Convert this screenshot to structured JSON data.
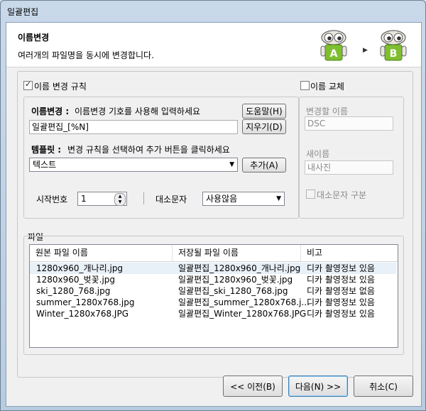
{
  "window": {
    "title": "일괄편집"
  },
  "header": {
    "title": "이름변경",
    "subtitle": "여러개의 파일명을 동시에 변경합니다.",
    "robot_a": "A",
    "robot_b": "B"
  },
  "rename_rule": {
    "checkbox_label": "이름 변경 규칙",
    "checked": true,
    "name_label_bold": "이름변경 :",
    "name_label_desc": " 이름변경 기호를 사용해 입력하세요",
    "help_button": "도움말(H)",
    "clear_button": "지우기(D)",
    "name_value": "일괄편집_[%N]",
    "template_label_bold": "템플릿 :",
    "template_label_desc": " 변경 규칙을 선택하여 추가 버튼을 클릭하세요",
    "template_value": "텍스트",
    "add_button": "추가(A)",
    "start_no_label": "시작번호",
    "start_no_value": "1",
    "case_label": "대소문자",
    "case_value": "사용않음"
  },
  "name_replace": {
    "checkbox_label": "이름 교체",
    "checked": false,
    "find_label": "변경할 이름",
    "find_value": "DSC",
    "new_label": "새이름",
    "new_value": "내사진",
    "case_sensitive_label": "대소문자 구분"
  },
  "files": {
    "group_label": "파일",
    "columns": [
      "원본 파일 이름",
      "저장될 파일 이름",
      "비고"
    ],
    "rows": [
      [
        "1280x960_개나리.jpg",
        "일괄편집_1280x960_개나리.jpg",
        "디카 촬영정보 있음"
      ],
      [
        "1280x960_벚꽃.jpg",
        "일괄편집_1280x960_벚꽃.jpg",
        "디카 촬영정보 있음"
      ],
      [
        "ski_1280_768.jpg",
        "일괄편집_ski_1280_768.jpg",
        "디카 촬영정보 없음"
      ],
      [
        "summer_1280x768.jpg",
        "일괄편집_summer_1280x768.j...",
        "디카 촬영정보 있음"
      ],
      [
        "Winter_1280x768.JPG",
        "일괄편집_Winter_1280x768.JPG",
        "디카 촬영정보 있음"
      ]
    ]
  },
  "footer": {
    "prev_button": "<< 이전(B)",
    "next_button": "다음(N) >>",
    "cancel_button": "취소(C)"
  },
  "colors": {
    "robot_green": "#7fbf2f",
    "robot_body": "#e9e6dc",
    "accent_border": "#3c7fb1"
  }
}
